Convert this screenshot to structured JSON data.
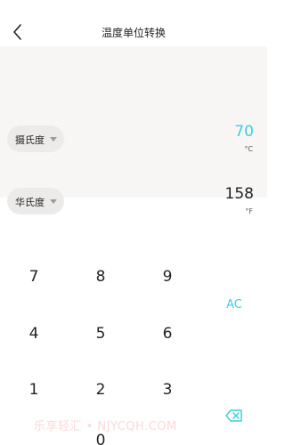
{
  "header": {
    "title": "温度单位转换"
  },
  "converter": {
    "from": {
      "unit_label": "摄氏度",
      "value": "70",
      "unit_symbol": "°C"
    },
    "to": {
      "unit_label": "华氏度",
      "value": "158",
      "unit_symbol": "°F"
    }
  },
  "keypad": {
    "keys": [
      "7",
      "8",
      "9",
      "4",
      "5",
      "6",
      "1",
      "2",
      "3",
      "0"
    ],
    "clear_label": "AC"
  },
  "watermark": "乐享轻汇 • NJYCQH.COM",
  "colors": {
    "accent": "#3fcfd8",
    "panel_bg": "#f7f6f4",
    "pill_bg": "#ecebea"
  },
  "icons": {
    "back": "chevron-left-icon",
    "delete": "backspace-icon",
    "dropdown": "caret-down-icon"
  }
}
